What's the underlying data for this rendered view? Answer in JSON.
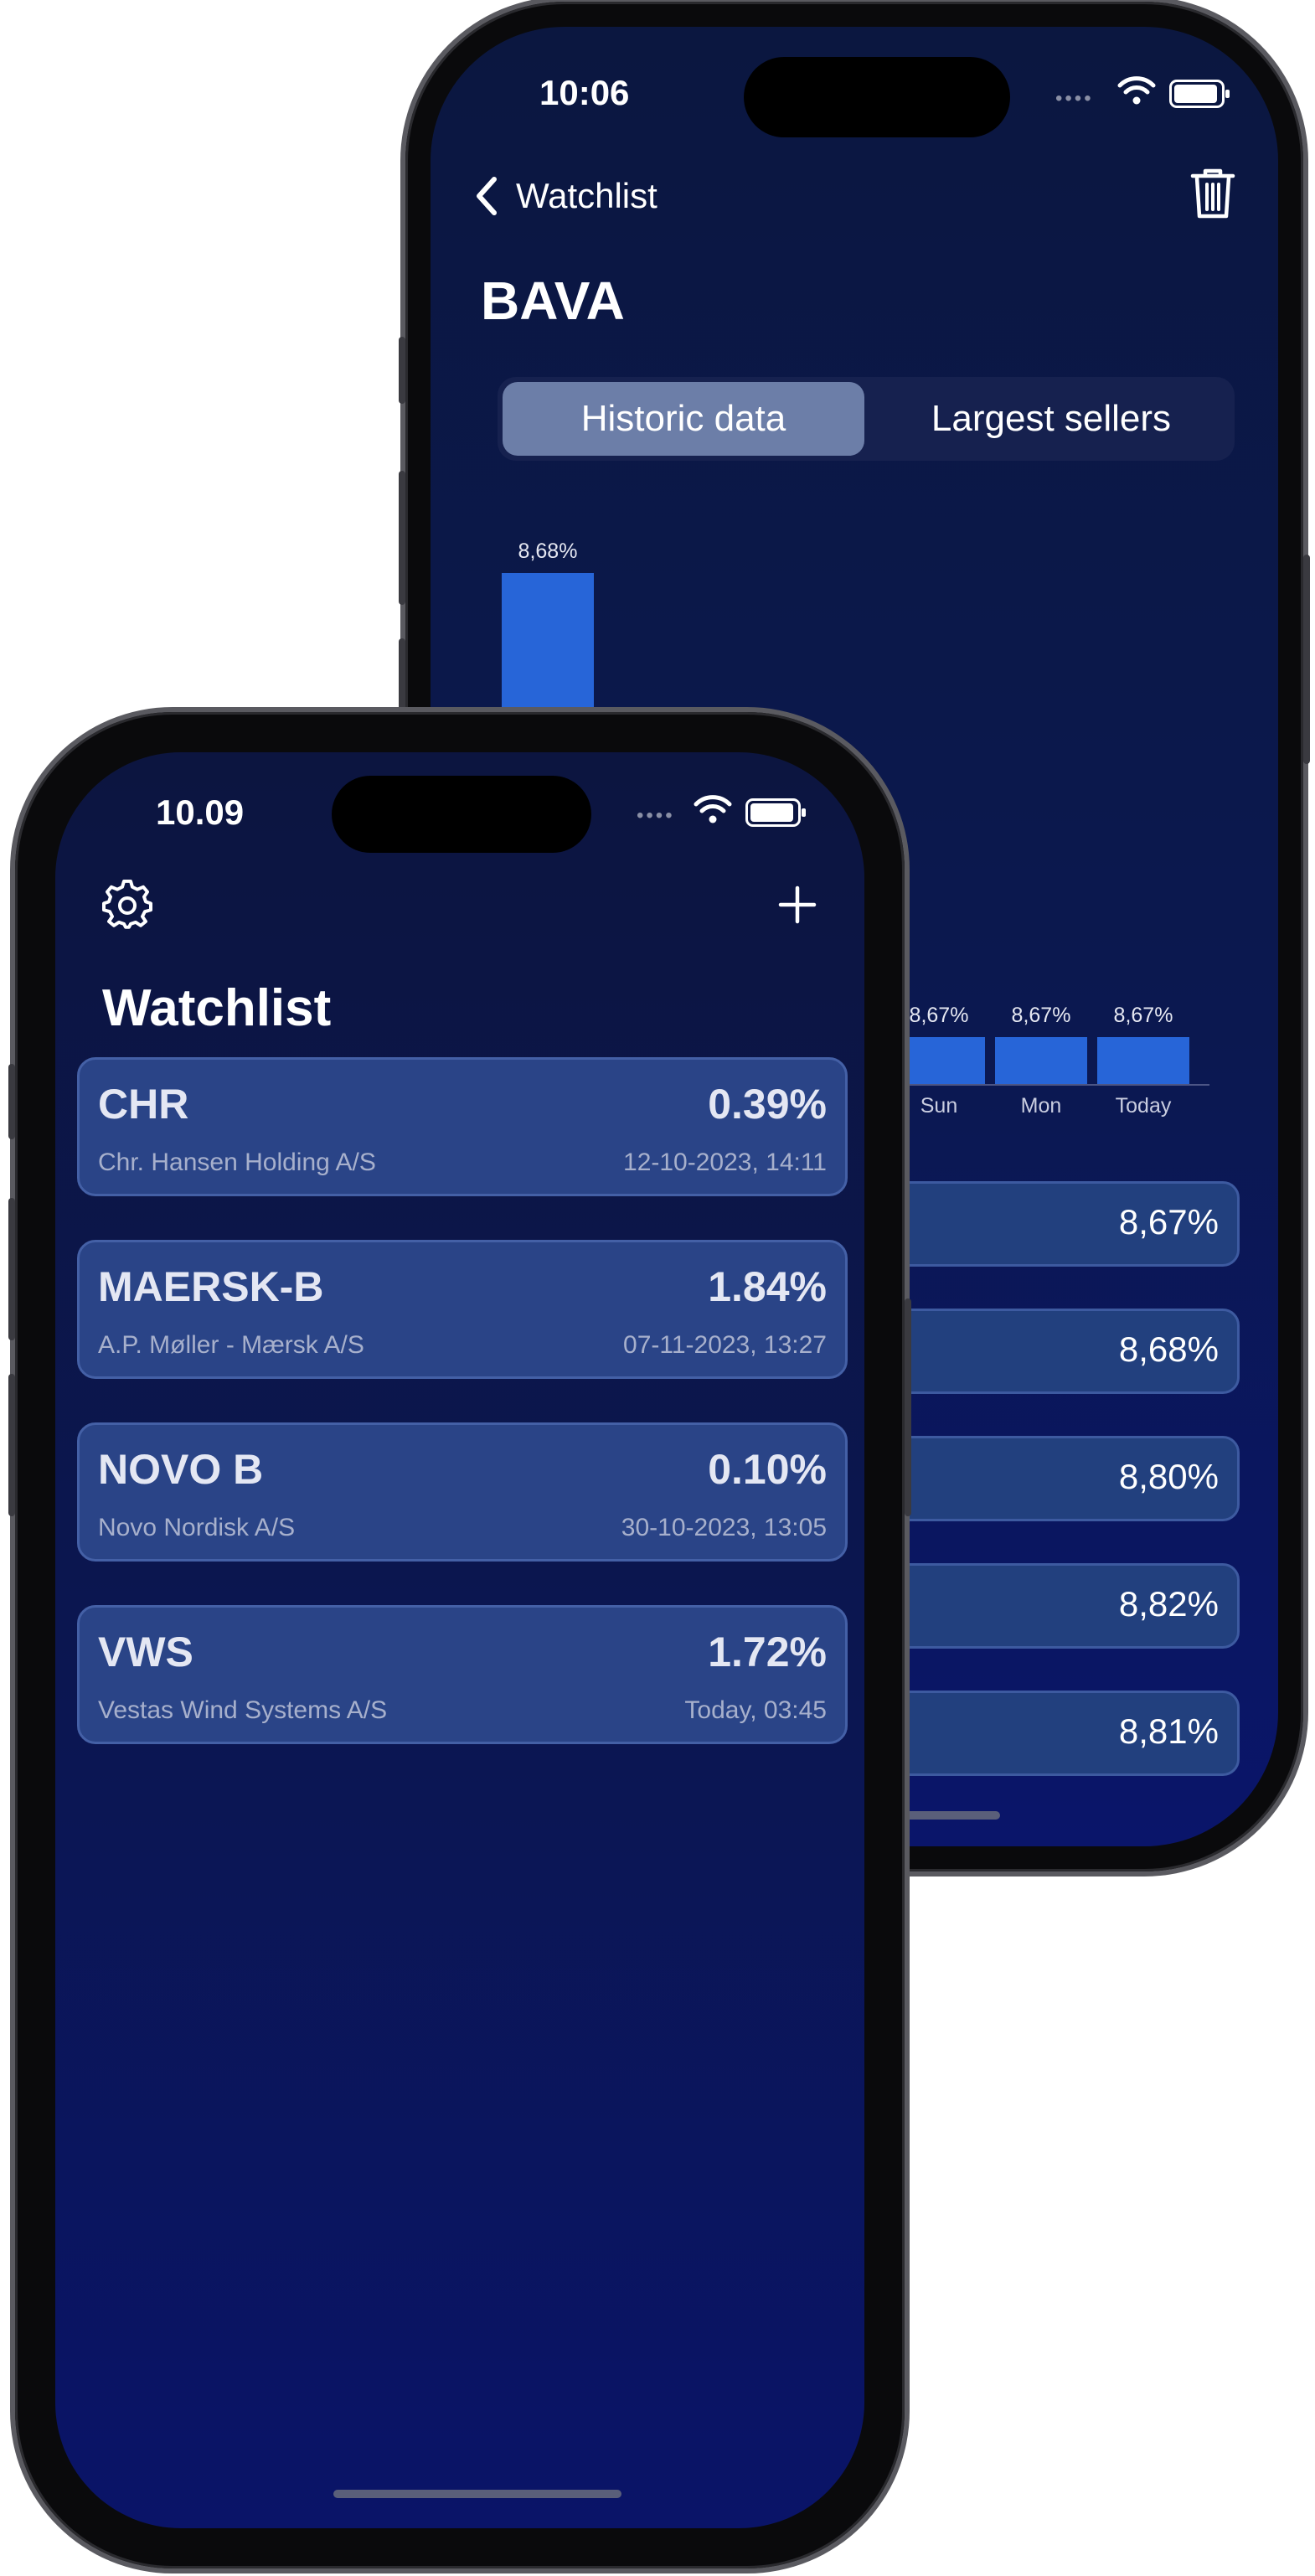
{
  "back_screen": {
    "status_time": "10:06",
    "nav_back_label": "Watchlist",
    "title": "BAVA",
    "segments": [
      "Historic data",
      "Largest sellers"
    ],
    "active_segment": "Historic data",
    "chart_data": {
      "type": "bar",
      "categories": [
        "",
        "Sun",
        "Mon",
        "Today"
      ],
      "values": [
        8.68,
        8.67,
        8.67,
        8.67
      ],
      "value_labels": [
        "8,68%",
        "8,67%",
        "8,67%",
        "8,67%"
      ]
    },
    "rows": [
      "8,67%",
      "8,68%",
      "8,80%",
      "8,82%",
      "8,81%"
    ]
  },
  "front_screen": {
    "status_time": "10.09",
    "title": "Watchlist",
    "items": [
      {
        "symbol": "CHR",
        "name": "Chr. Hansen Holding A/S",
        "change": "0.39%",
        "date": "12-10-2023, 14:11"
      },
      {
        "symbol": "MAERSK-B",
        "name": "A.P. Møller - Mærsk A/S",
        "change": "1.84%",
        "date": "07-11-2023, 13:27"
      },
      {
        "symbol": "NOVO B",
        "name": "Novo Nordisk A/S",
        "change": "0.10%",
        "date": "30-10-2023, 13:05"
      },
      {
        "symbol": "VWS",
        "name": "Vestas Wind Systems A/S",
        "change": "1.72%",
        "date": "Today, 03:45"
      }
    ]
  },
  "icons": {
    "back_chevron": "chevron-left-icon",
    "trash": "trash-icon",
    "settings": "gear-icon",
    "add": "plus-icon"
  },
  "colors": {
    "background": "#0b1652",
    "card": "#2a4487",
    "bar": "#2765d8",
    "segment_active": "#6c7ea8"
  }
}
